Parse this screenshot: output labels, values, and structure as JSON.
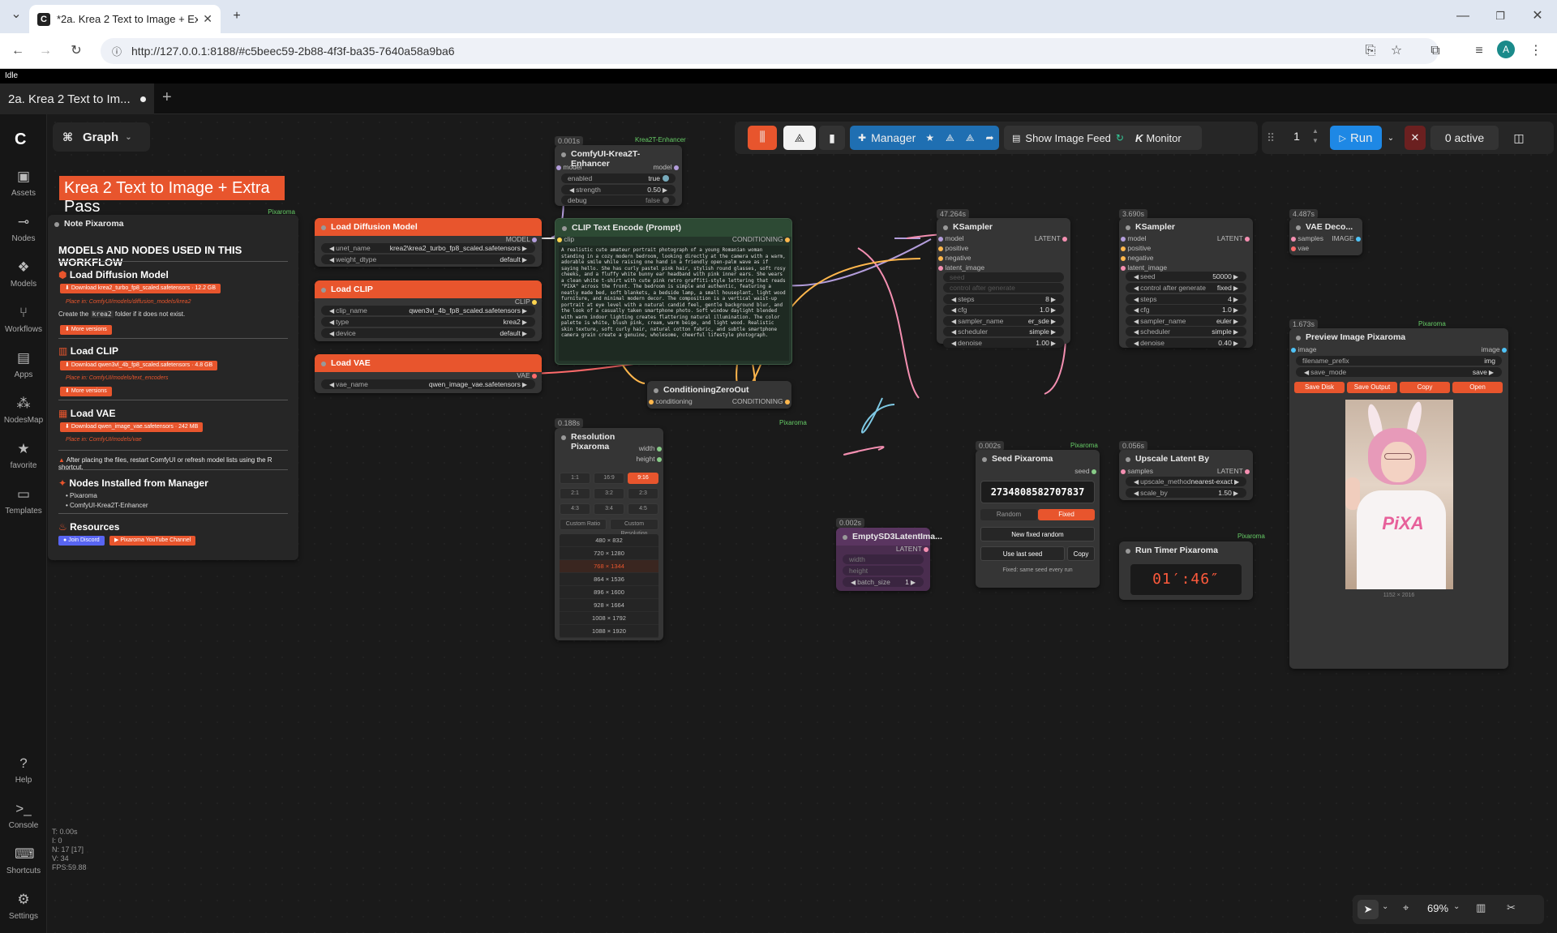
{
  "browser": {
    "tab_title": "*2a. Krea 2 Text to Image + Extr",
    "url": "http://127.0.0.1:8188/#c5beec59-2b88-4f3f-ba35-7640a58a9ba6",
    "avatar": "A"
  },
  "app": {
    "status": "Idle",
    "workflow_tab": "2a. Krea 2 Text to Im...",
    "graph_label": "Graph"
  },
  "sidebar": {
    "items": [
      {
        "label": "Assets",
        "icon": "image-icon"
      },
      {
        "label": "Nodes",
        "icon": "nodes-icon"
      },
      {
        "label": "Models",
        "icon": "models-icon"
      },
      {
        "label": "Workflows",
        "icon": "workflow-icon"
      },
      {
        "label": "Apps",
        "icon": "apps-icon"
      },
      {
        "label": "NodesMap",
        "icon": "map-icon"
      },
      {
        "label": "favorite",
        "icon": "star-icon"
      },
      {
        "label": "Templates",
        "icon": "templates-icon"
      }
    ],
    "bottom": [
      {
        "label": "Help",
        "icon": "help-icon"
      },
      {
        "label": "Console",
        "icon": "console-icon"
      },
      {
        "label": "Shortcuts",
        "icon": "keyboard-icon"
      },
      {
        "label": "Settings",
        "icon": "gear-icon"
      }
    ]
  },
  "toolbar": {
    "manager": "Manager",
    "show_feed": "Show Image Feed",
    "monitor": "Monitor",
    "batch_count": "1",
    "run": "Run",
    "active": "0 active"
  },
  "workflow_title": "Krea 2 Text to Image + Extra Pass",
  "note": {
    "title": "Note Pixaroma",
    "tag": "Pixaroma",
    "heading": "MODELS AND NODES USED IN THIS WORKFLOW",
    "s1": "Load Diffusion Model",
    "s1_dl": "Download krea2_turbo_fp8_scaled.safetensors  ·  12.2 GB",
    "s1_place": "Place in: ComfyUI/models/diffusion_models/krea2",
    "s1_create_a": "Create the",
    "s1_create_code": "krea2",
    "s1_create_b": "folder if it does not exist.",
    "more": "More versions",
    "s2": "Load CLIP",
    "s2_dl": "Download qwen3vl_4b_fp8_scaled.safetensors  ·  4.8 GB",
    "s2_place": "Place in: ComfyUI/models/text_encoders",
    "s3": "Load VAE",
    "s3_dl": "Download qwen_image_vae.safetensors  ·  242 MB",
    "s3_place": "Place in: ComfyUI/models/vae",
    "warning": "After placing the files, restart ComfyUI or refresh model lists using the R shortcut.",
    "s4": "Nodes Installed from Manager",
    "s4_items": [
      "Pixaroma",
      "ComfyUI-Krea2T-Enhancer"
    ],
    "s5": "Resources",
    "discord": "Join Discord",
    "youtube": "Pixaroma YouTube Channel"
  },
  "nodes": {
    "enhancer": {
      "time": "0.001s",
      "tag": "Krea2T-Enhancer",
      "title": "ComfyUI-Krea2T-Enhancer",
      "in": "model",
      "out": "model",
      "w1": "enabled",
      "v1": "true",
      "w2": "strength",
      "v2": "0.50",
      "w3": "debug",
      "v3": "false"
    },
    "diffusion": {
      "title": "Load Diffusion Model",
      "out": "MODEL",
      "w1": "unet_name",
      "v1": "krea2\\krea2_turbo_fp8_scaled.safetensors",
      "w2": "weight_dtype",
      "v2": "default"
    },
    "clip": {
      "title": "Load CLIP",
      "out": "CLIP",
      "w1": "clip_name",
      "v1": "qwen3vl_4b_fp8_scaled.safetensors",
      "w2": "type",
      "v2": "krea2",
      "w3": "device",
      "v3": "default"
    },
    "vae": {
      "title": "Load VAE",
      "out": "VAE",
      "w1": "vae_name",
      "v1": "qwen_image_vae.safetensors"
    },
    "encode": {
      "title": "CLIP Text Encode (Prompt)",
      "in": "clip",
      "out": "CONDITIONING",
      "prompt": "A realistic cute amateur portrait photograph of a young Romanian woman standing in a cozy modern bedroom, looking directly at the camera with a warm, adorable smile while raising one hand in a friendly open-palm wave as if saying hello. She has curly pastel pink hair, stylish round glasses, soft rosy cheeks, and a fluffy white bunny ear headband with pink inner ears. She wears a clean white t-shirt with cute pink retro graffiti-style lettering that reads \"PIXA\" across the front. The bedroom is simple and authentic, featuring a neatly made bed, soft blankets, a bedside lamp, a small houseplant, light wood furniture, and minimal modern decor. The composition is a vertical waist-up portrait at eye level with a natural candid feel, gentle background blur, and the look of a casually taken smartphone photo. Soft window daylight blended with warm indoor lighting creates flattering natural illumination. The color palette is white, blush pink, cream, warm beige, and light wood. Realistic skin texture, soft curly hair, natural cotton fabric, and subtle smartphone camera grain create a genuine, wholesome, cheerful lifestyle photograph."
    },
    "ks1": {
      "time": "47.264s",
      "title": "KSampler",
      "ins": [
        "model",
        "positive",
        "negative",
        "latent_image"
      ],
      "out": "LATENT",
      "seed": "seed",
      "cag": "control after generate",
      "widgets": [
        [
          "steps",
          "8"
        ],
        [
          "cfg",
          "1.0"
        ],
        [
          "sampler_name",
          "er_sde"
        ],
        [
          "scheduler",
          "simple"
        ],
        [
          "denoise",
          "1.00"
        ]
      ]
    },
    "ks2": {
      "time": "3.690s",
      "title": "KSampler",
      "ins": [
        "model",
        "positive",
        "negative",
        "latent_image"
      ],
      "out": "LATENT",
      "widgets": [
        [
          "seed",
          "50000"
        ],
        [
          "control after generate",
          "fixed"
        ],
        [
          "steps",
          "4"
        ],
        [
          "cfg",
          "1.0"
        ],
        [
          "sampler_name",
          "euler"
        ],
        [
          "scheduler",
          "simple"
        ],
        [
          "denoise",
          "0.40"
        ]
      ]
    },
    "vaed": {
      "time": "4.487s",
      "title": "VAE Deco...",
      "ins": [
        "samples",
        "vae"
      ],
      "out": "IMAGE"
    },
    "czero": {
      "title": "ConditioningZeroOut",
      "in": "conditioning",
      "out": "CONDITIONING"
    },
    "res": {
      "time": "0.188s",
      "tag": "Pixaroma",
      "title": "Resolution Pixaroma",
      "out1": "width",
      "out2": "height",
      "ratios": [
        "1:1",
        "16:9",
        "9:16",
        "2:1",
        "3:2",
        "2:3",
        "4:3",
        "3:4",
        "4:5"
      ],
      "custom1": "Custom Ratio",
      "custom2": "Custom Resolution",
      "sizes": [
        "480 × 832",
        "720 × 1280",
        "768 × 1344",
        "864 × 1536",
        "896 × 1600",
        "928 × 1664",
        "1008 × 1792",
        "1088 × 1920"
      ]
    },
    "empty": {
      "time": "0.002s",
      "title": "EmptySD3LatentIma...",
      "out": "LATENT",
      "w1": "width",
      "w2": "height",
      "w3": "batch_size",
      "v3": "1"
    },
    "seed": {
      "time": "0.002s",
      "tag": "Pixaroma",
      "title": "Seed Pixaroma",
      "out": "seed",
      "value": "2734808582707837",
      "random": "Random",
      "fixed": "Fixed",
      "newfixed": "New fixed random",
      "uselast": "Use last seed",
      "copy": "Copy",
      "note": "Fixed: same seed every run"
    },
    "upscale": {
      "time": "0.056s",
      "title": "Upscale Latent By",
      "in": "samples",
      "out": "LATENT",
      "w1": "upscale_method",
      "v1": "nearest-exact",
      "w2": "scale_by",
      "v2": "1.50"
    },
    "timer": {
      "tag": "Pixaroma",
      "title": "Run Timer Pixaroma",
      "value": "01′:46″"
    },
    "preview": {
      "time": "1.673s",
      "tag": "Pixaroma",
      "title": "Preview Image Pixaroma",
      "in": "image",
      "out": "image",
      "w1": "filename_prefix",
      "v1": "img",
      "w2": "save_mode",
      "v2": "save",
      "b1": "Save Disk",
      "b2": "Save Output",
      "b3": "Copy",
      "b4": "Open",
      "size": "1152 × 2016",
      "shirt": "PiXA"
    }
  },
  "stats": {
    "t": "T: 0.00s",
    "i": "I: 0",
    "n": "N: 17 [17]",
    "v": "V: 34",
    "fps": "FPS:59.88"
  },
  "zoom": "69%",
  "colors": {
    "accent": "#e8552d",
    "run": "#1e88e5",
    "manager": "#1f6fb2"
  }
}
